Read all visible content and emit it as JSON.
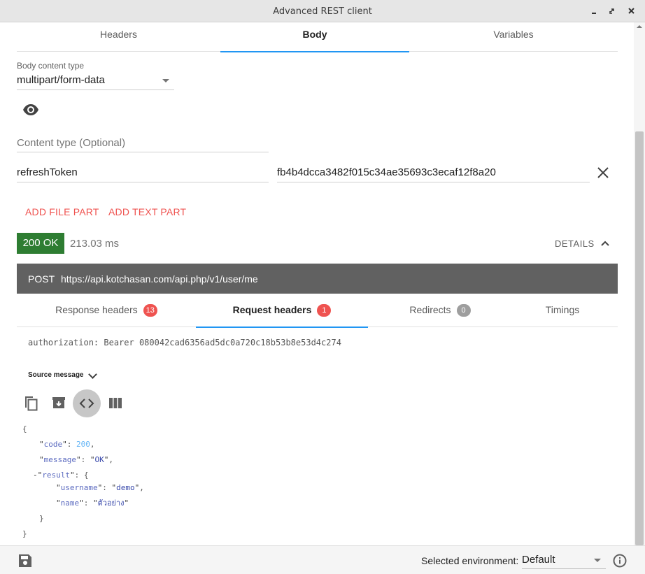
{
  "window": {
    "title": "Advanced REST client"
  },
  "top_tabs": [
    {
      "label": "Headers",
      "active": false
    },
    {
      "label": "Body",
      "active": true
    },
    {
      "label": "Variables",
      "active": false
    }
  ],
  "body": {
    "content_type_label": "Body content type",
    "content_type_value": "multipart/form-data",
    "content_type_field_placeholder": "Content type (Optional)",
    "field_name": "refreshToken",
    "field_value": "fb4b4dcca3482f015c34ae35693c3ecaf12f8a20",
    "add_file_part": "ADD FILE PART",
    "add_text_part": "ADD TEXT PART"
  },
  "response": {
    "status": "200 OK",
    "status_color": "#2e7d32",
    "time": "213.03 ms",
    "details_label": "DETAILS",
    "method": "POST",
    "url": "https://api.kotchasan.com/api.php/v1/user/me",
    "tabs": [
      {
        "label": "Response headers",
        "count": "13",
        "count_color": "#ef5350",
        "active": false
      },
      {
        "label": "Request headers",
        "count": "1",
        "count_color": "#ef5350",
        "active": true
      },
      {
        "label": "Redirects",
        "count": "0",
        "count_color": "#9e9e9e",
        "active": false
      },
      {
        "label": "Timings",
        "active": false
      }
    ],
    "request_header_line": "authorization: Bearer 080042cad6356ad5dc0a720c18b53b8e53d4c274",
    "source_message_label": "Source message",
    "json": {
      "open_brace": "{",
      "code_key": "code",
      "code_value": "200",
      "message_key": "message",
      "message_value": "OK",
      "result_key": "result",
      "collapse_marker": "-",
      "username_key": "username",
      "username_value": "demo",
      "name_key": "name",
      "name_value": "ตัวอย่าง",
      "inner_close": "}",
      "close_brace": "}"
    }
  },
  "footer": {
    "env_label": "Selected environment:",
    "env_value": "Default"
  },
  "colors": {
    "accent": "#2196f3",
    "action_red": "#ef5350",
    "url_bar": "#616161"
  }
}
